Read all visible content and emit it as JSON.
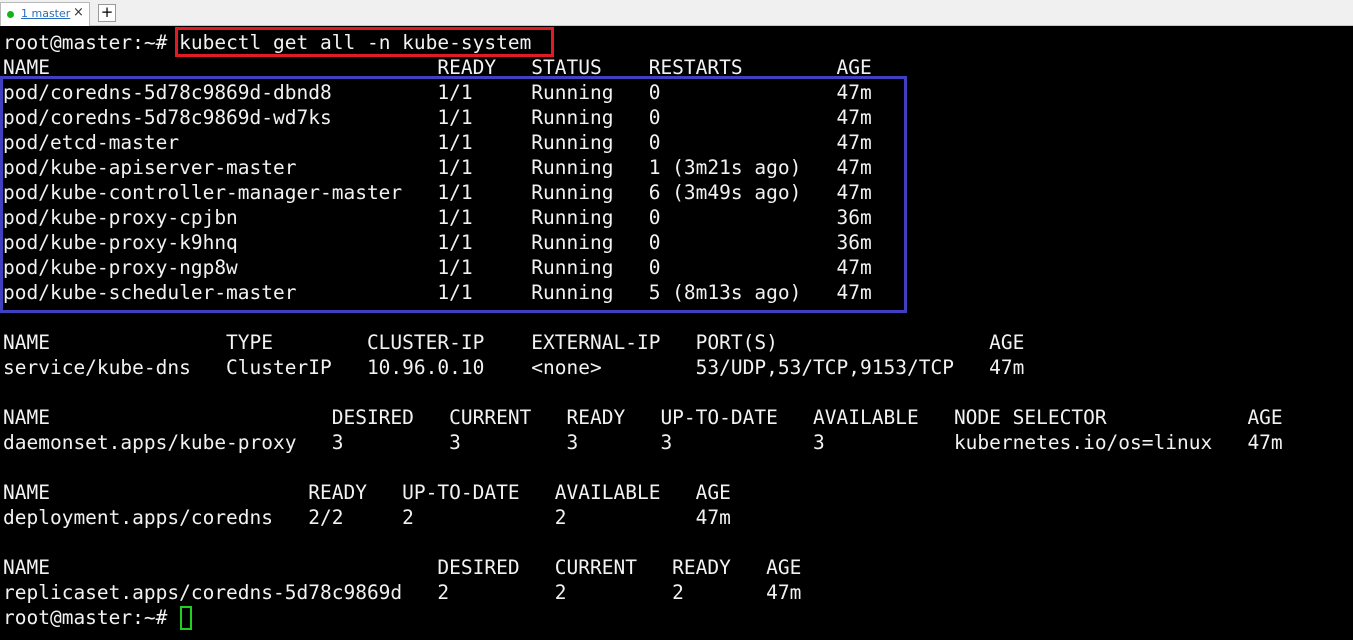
{
  "tab": {
    "index_title": "1 master",
    "close_glyph": "×",
    "new_tab_glyph": "+",
    "status_color": "#16b21a"
  },
  "prompt": "root@master:~# ",
  "command": "kubectl get all -n kube-system",
  "terminal_lines": [
    "NAME                                 READY   STATUS    RESTARTS        AGE",
    "pod/coredns-5d78c9869d-dbnd8         1/1     Running   0               47m",
    "pod/coredns-5d78c9869d-wd7ks         1/1     Running   0               47m",
    "pod/etcd-master                      1/1     Running   0               47m",
    "pod/kube-apiserver-master            1/1     Running   1 (3m21s ago)   47m",
    "pod/kube-controller-manager-master   1/1     Running   6 (3m49s ago)   47m",
    "pod/kube-proxy-cpjbn                 1/1     Running   0               36m",
    "pod/kube-proxy-k9hnq                 1/1     Running   0               36m",
    "pod/kube-proxy-ngp8w                 1/1     Running   0               47m",
    "pod/kube-scheduler-master            1/1     Running   5 (8m13s ago)   47m",
    "",
    "NAME               TYPE        CLUSTER-IP    EXTERNAL-IP   PORT(S)                  AGE",
    "service/kube-dns   ClusterIP   10.96.0.10    <none>        53/UDP,53/TCP,9153/TCP   47m",
    "",
    "NAME                        DESIRED   CURRENT   READY   UP-TO-DATE   AVAILABLE   NODE SELECTOR            AGE",
    "daemonset.apps/kube-proxy   3         3         3       3            3           kubernetes.io/os=linux   47m",
    "",
    "NAME                      READY   UP-TO-DATE   AVAILABLE   AGE",
    "deployment.apps/coredns   2/2     2            2           47m",
    "",
    "NAME                                 DESIRED   CURRENT   READY   AGE",
    "replicaset.apps/coredns-5d78c9869d   2         2         2       47m"
  ],
  "final_prompt": "root@master:~# ",
  "highlight_colors": {
    "command_box": "#e01b24",
    "pods_box": "#3f3fbf",
    "cursor": "#1fd11f"
  }
}
